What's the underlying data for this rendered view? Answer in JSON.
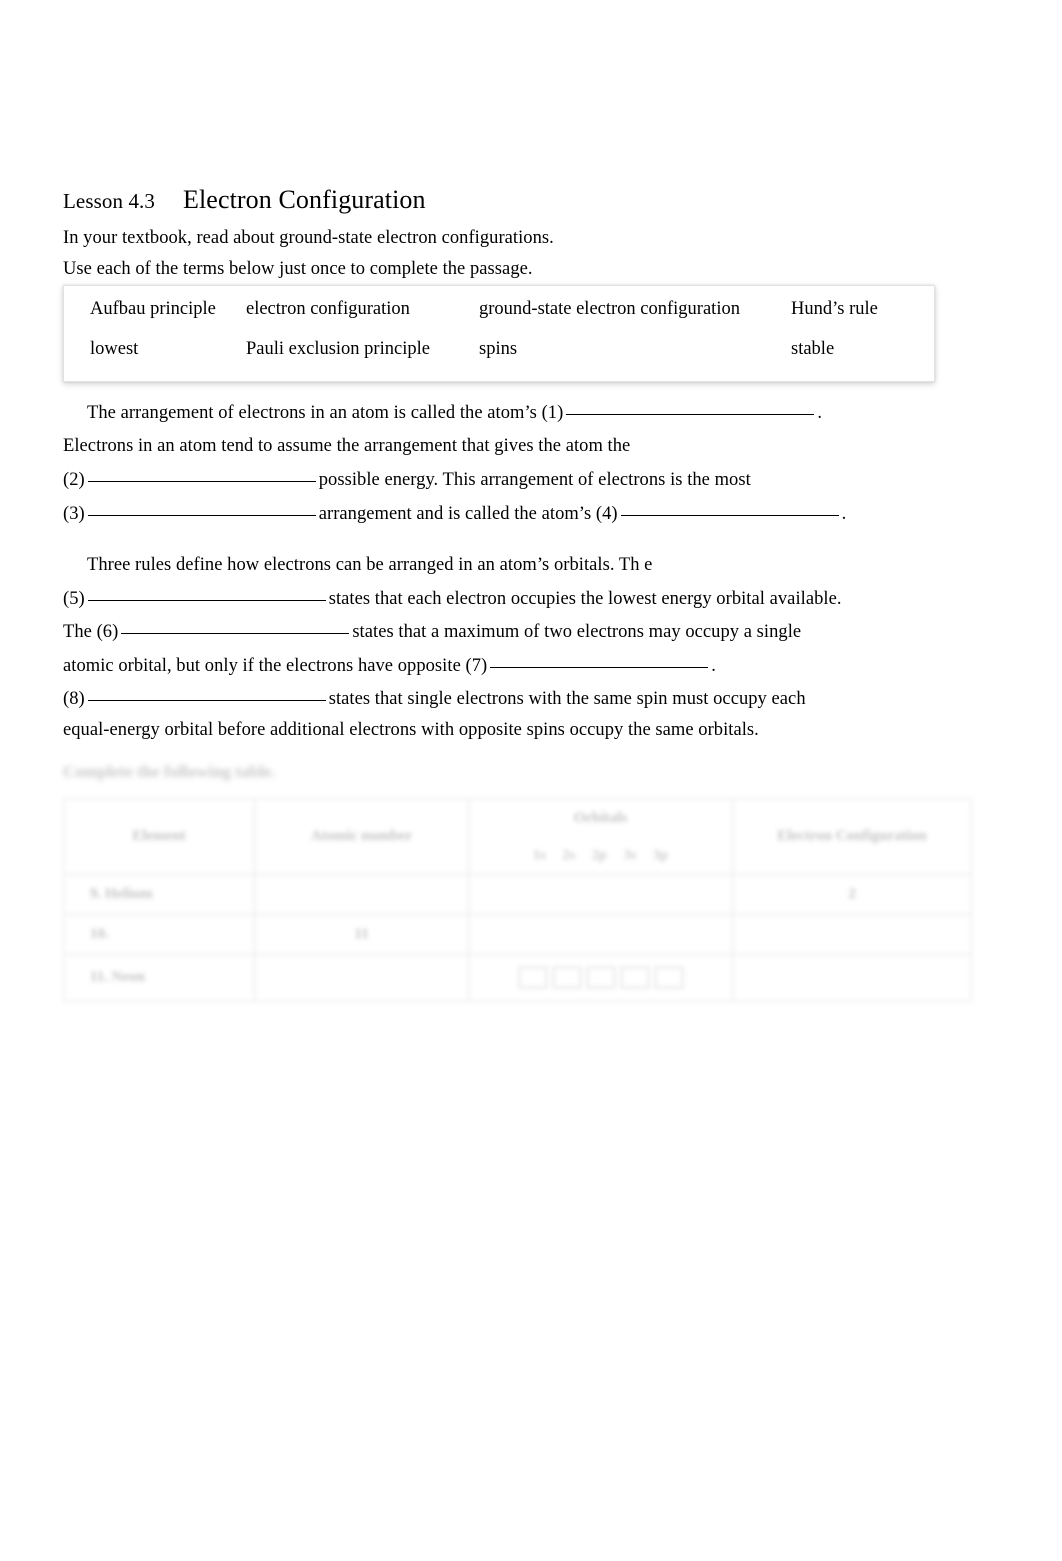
{
  "document": {
    "lesson_label": "Lesson 4.3",
    "title": "Electron Configuration",
    "intro_line_1": "In your textbook, read about ground-state electron configurations.",
    "intro_line_2": "Use each of the terms below just once to complete the passage."
  },
  "word_bank": {
    "row1": {
      "c1": "Aufbau principle",
      "c2": "electron configuration",
      "c3": "ground-state electron configuration",
      "c4": "Hund’s rule"
    },
    "row2": {
      "c1": "lowest",
      "c2": "Pauli exclusion principle",
      "c3": "spins",
      "c4": "stable"
    }
  },
  "passage": {
    "p1_l1_a": "The arrangement of electrons in an atom is called the atom’s (1)",
    "p1_l1_b": ".",
    "p1_l2": "Electrons in an atom tend to assume the arrangement that gives the atom the",
    "p1_l3_a": "(2)",
    "p1_l3_b": "possible energy. This arrangement of electrons is the most",
    "p1_l4_a": "(3)",
    "p1_l4_b": "arrangement and is called the atom’s (4)",
    "p1_l4_c": ".",
    "p2_l1": "Three rules define how electrons can be arranged in an atom’s orbitals. Th e",
    "p2_l2_a": "(5)",
    "p2_l2_b": "states that each electron occupies the lowest energy orbital available.",
    "p2_l3_a": "The (6)",
    "p2_l3_b": "states that a maximum of two electrons may occupy a single",
    "p2_l4_a": "atomic orbital, but only if the electrons have opposite (7)",
    "p2_l4_b": ".",
    "p2_l5_a": "(8)",
    "p2_l5_b": "states that single electrons with the same spin must occupy each",
    "p2_l6": "equal-energy orbital before additional electrons with opposite spins occupy the same orbitals."
  },
  "faded_section": {
    "heading": "Complete the following table.",
    "table": {
      "headers": {
        "element": "Element",
        "atomic_number": "Atomic number",
        "orbitals": "Orbitals",
        "configuration": "Electron Configuration"
      },
      "orbital_sublabels": [
        "1s",
        "2s",
        "2p",
        "3s",
        "3p"
      ],
      "rows": [
        {
          "element": "9. Helium",
          "atomic_number": "",
          "orbitals": "",
          "configuration": "2"
        },
        {
          "element": "10.",
          "atomic_number": "11",
          "orbitals": "",
          "configuration": ""
        },
        {
          "element": "11. Neon",
          "atomic_number": "",
          "orbitals": "boxes",
          "configuration": ""
        }
      ]
    }
  }
}
